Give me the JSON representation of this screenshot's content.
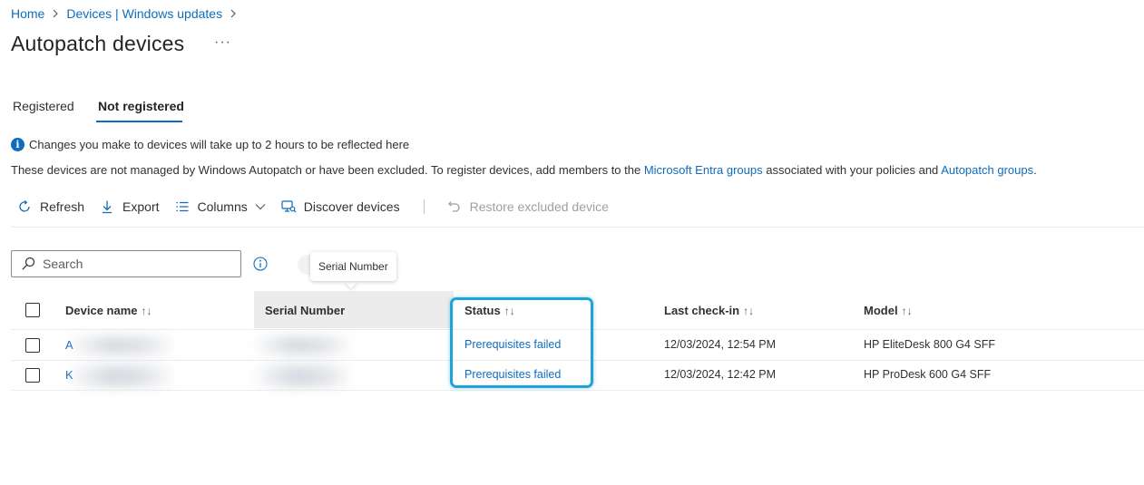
{
  "breadcrumb": {
    "items": [
      "Home",
      "Devices | Windows updates"
    ],
    "separator": ">"
  },
  "page": {
    "title": "Autopatch devices",
    "more_label": "···"
  },
  "tabs": [
    {
      "label": "Registered",
      "active": false
    },
    {
      "label": "Not registered",
      "active": true
    }
  ],
  "notice": {
    "icon": "info-icon",
    "text": "Changes you make to devices will take up to 2 hours to be reflected here"
  },
  "description": {
    "text_1": "These devices are not managed by Windows Autopatch or have been excluded. To register devices, add members to the ",
    "link_1": "Microsoft Entra groups",
    "text_2": " associated with your policies and ",
    "link_2": "Autopatch groups",
    "text_3": "."
  },
  "toolbar": {
    "refresh_label": "Refresh",
    "export_label": "Export",
    "columns_label": "Columns",
    "discover_label": "Discover devices",
    "restore_label": "Restore excluded device"
  },
  "search": {
    "placeholder": "Search",
    "value": ""
  },
  "tooltip": {
    "text": "Serial Number"
  },
  "table": {
    "headers": {
      "device_name": "Device name",
      "serial_number": "Serial Number",
      "status": "Status",
      "last_checkin": "Last check-in",
      "model": "Model",
      "sort_glyph": "↑↓"
    },
    "rows": [
      {
        "device_name": "A",
        "status": "Prerequisites failed",
        "last_checkin": "12/03/2024, 12:54 PM",
        "model": "HP EliteDesk 800 G4 SFF"
      },
      {
        "device_name": "K",
        "status": "Prerequisites failed",
        "last_checkin": "12/03/2024, 12:42 PM",
        "model": "HP ProDesk 600 G4 SFF"
      }
    ]
  },
  "colors": {
    "accent": "#0f6cbd",
    "highlight": "#1ea4d9",
    "text": "#323130"
  }
}
